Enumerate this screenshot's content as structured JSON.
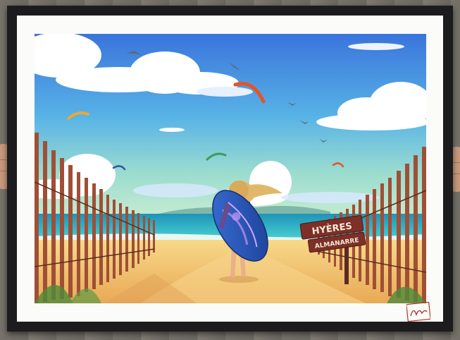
{
  "poster": {
    "sign_line1": "HYÈRES",
    "sign_line2": "ALMANARRE",
    "signature_text": "Vincent"
  },
  "colors": {
    "frame": "#1c1c1e",
    "mat": "#fbfbf9",
    "sky_top": "#3a7ee0",
    "sky_horizon": "#8fd9d0",
    "sea": "#2fb7c9",
    "sand": "#f2c46e",
    "fence": "#9c4b34",
    "sign": "#7e2f27",
    "surfboard": "#2d5bc4"
  }
}
